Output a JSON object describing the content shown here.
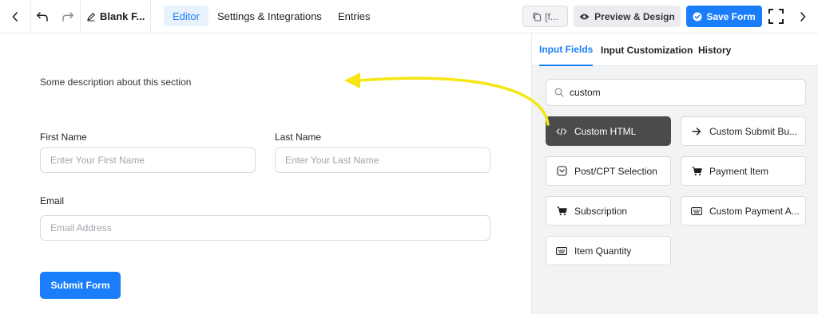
{
  "header": {
    "form_title": "Blank F...",
    "tabs": [
      {
        "label": "Editor",
        "active": true
      },
      {
        "label": "Settings & Integrations",
        "active": false
      },
      {
        "label": "Entries",
        "active": false
      }
    ],
    "shortcode_label": "[f...",
    "preview_label": "Preview & Design",
    "save_label": "Save Form"
  },
  "form": {
    "section_description": "Some description about this section",
    "first_name": {
      "label": "First Name",
      "placeholder": "Enter Your First Name",
      "value": ""
    },
    "last_name": {
      "label": "Last Name",
      "placeholder": "Enter Your Last Name",
      "value": ""
    },
    "email": {
      "label": "Email",
      "placeholder": "Email Address",
      "value": ""
    },
    "submit_label": "Submit Form"
  },
  "panel": {
    "tabs": [
      {
        "label": "Input Fields",
        "active": true
      },
      {
        "label": "Input Customization",
        "active": false
      },
      {
        "label": "History",
        "active": false
      }
    ],
    "search": {
      "value": "custom",
      "placeholder": ""
    },
    "fields": [
      {
        "label": "Custom HTML",
        "icon": "code-icon",
        "active": true
      },
      {
        "label": "Custom Submit Bu...",
        "icon": "arrow-right-icon",
        "active": false
      },
      {
        "label": "Post/CPT Selection",
        "icon": "post-selection-icon",
        "active": false
      },
      {
        "label": "Payment Item",
        "icon": "cart-icon",
        "active": false
      },
      {
        "label": "Subscription",
        "icon": "cart-icon",
        "active": false
      },
      {
        "label": "Custom Payment A...",
        "icon": "keyboard-icon",
        "active": false
      },
      {
        "label": "Item Quantity",
        "icon": "keyboard-icon",
        "active": false
      }
    ]
  },
  "colors": {
    "accent": "#1a7efb",
    "annotation_arrow": "#f5e614",
    "active_field_bg": "#4a4b4d",
    "panel_bg": "#f2f3f5"
  }
}
